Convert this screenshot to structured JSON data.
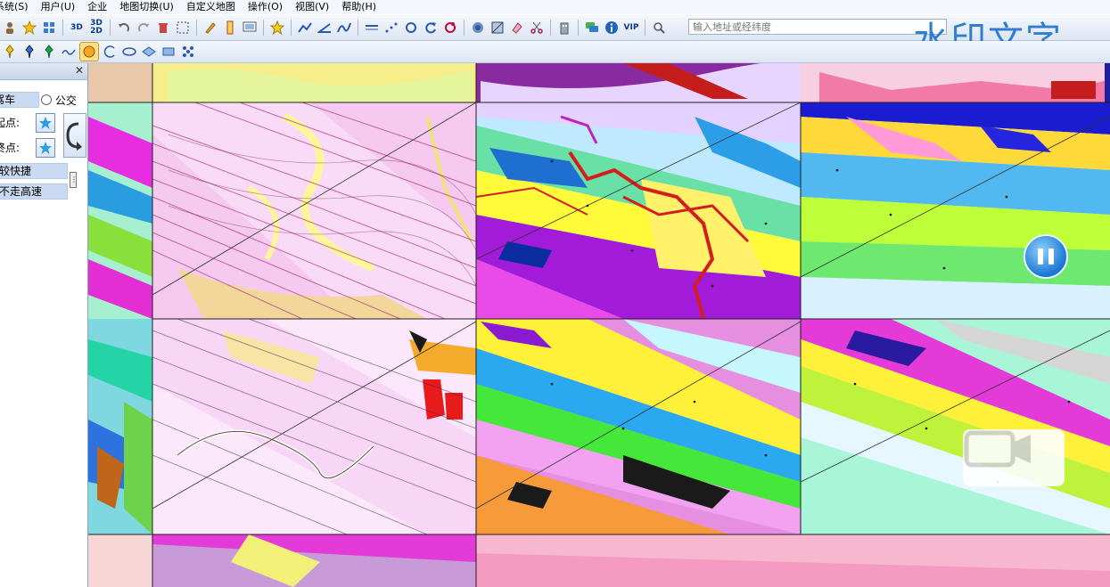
{
  "menu": {
    "items": [
      "系统(S)",
      "用户(U)",
      "企业",
      "地图切换(U)",
      "自定义地图",
      "操作(O)",
      "视图(V)",
      "帮助(H)"
    ]
  },
  "toolbar": {
    "btn_3d": "3D",
    "btn_3d2d_top": "3D",
    "btn_3d2d_bottom": "2D",
    "btn_vip": "VIP",
    "search_placeholder": "输入地址或经纬度"
  },
  "watermark": "水印文字",
  "route_panel": {
    "mode_car": "驾车",
    "mode_bus": "公交",
    "start_label": "起点:",
    "end_label": "终点:",
    "option_fast": "较快捷",
    "option_no_highway": "不走高速"
  },
  "icons": {
    "star": "star-icon",
    "swap": "swap-arrow-icon",
    "pause": "pause-icon",
    "video": "video-icon"
  },
  "colors": {
    "accent": "#2e7fd0",
    "panel_bar": "#c9daf2"
  }
}
